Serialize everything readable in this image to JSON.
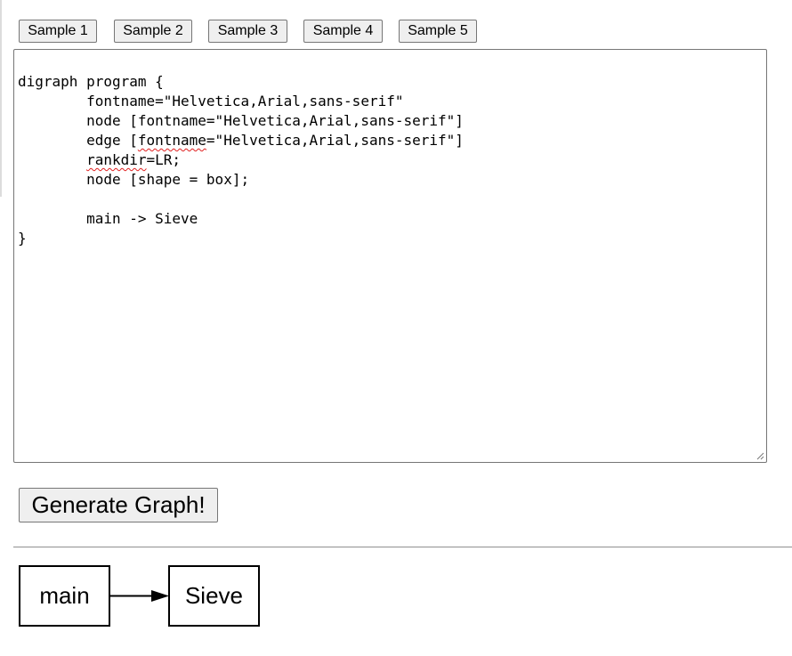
{
  "samples": [
    "Sample 1",
    "Sample 2",
    "Sample 3",
    "Sample 4",
    "Sample 5"
  ],
  "editor": {
    "lines": [
      "digraph program {",
      "        fontname=\"Helvetica,Arial,sans-serif\"",
      "        node [fontname=\"Helvetica,Arial,sans-serif\"]",
      "        edge [fontname=\"Helvetica,Arial,sans-serif\"]",
      "        rankdir=LR;",
      "        node [shape = box];",
      "",
      "        main -> Sieve",
      "}"
    ]
  },
  "generate_label": "Generate Graph!",
  "graph": {
    "nodes": [
      "main",
      "Sieve"
    ],
    "edge": {
      "from": "main",
      "to": "Sieve"
    }
  }
}
